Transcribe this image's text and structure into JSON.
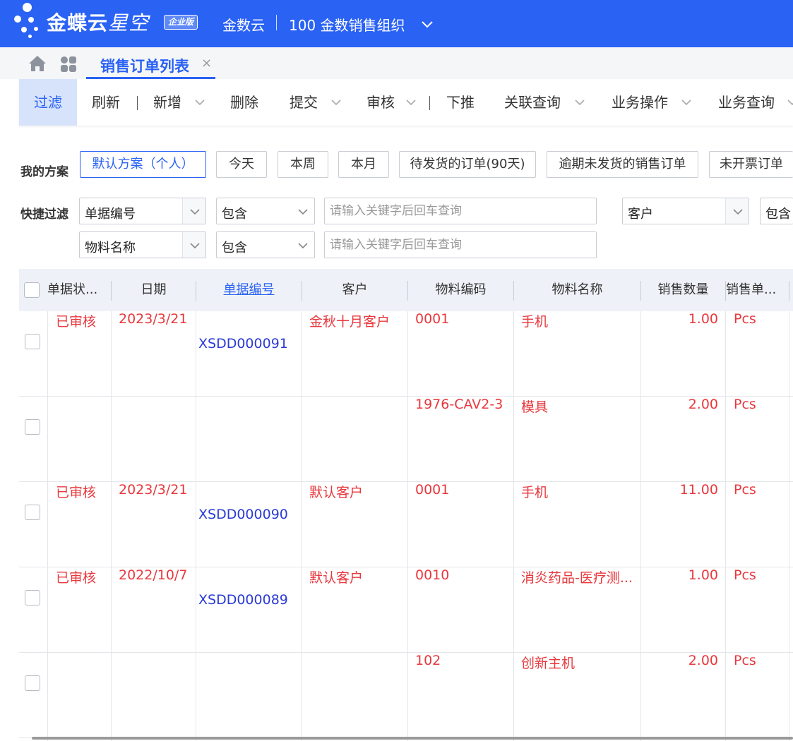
{
  "header": {
    "brand": "金蝶云",
    "brand_suffix": "星空",
    "edition": "企业版",
    "tenant": "金数云",
    "org": "100 金数销售组织",
    "accent": "#2a62f4"
  },
  "tabs": {
    "active_label": "销售订单列表",
    "close_glyph": "×"
  },
  "toolbar": {
    "filter": "过滤",
    "refresh": "刷新",
    "add": "新增",
    "delete": "删除",
    "submit": "提交",
    "audit": "审核",
    "push_down": "下推",
    "related_query": "关联查询",
    "business_ops": "业务操作",
    "business_query": "业务查询"
  },
  "filters": {
    "scheme_label": "我的方案",
    "schemes": [
      "默认方案（个人）",
      "今天",
      "本周",
      "本月",
      "待发货的订单(90天)",
      "逾期未发货的销售订单",
      "未开票订单"
    ],
    "quick_label": "快捷过滤",
    "row1": {
      "field": "单据编号",
      "op": "包含",
      "placeholder": "请输入关键字后回车查询",
      "field2": "客户",
      "op2": "包含"
    },
    "row2": {
      "field": "物料名称",
      "op": "包含",
      "placeholder": "请输入关键字后回车查询"
    }
  },
  "grid": {
    "columns": [
      "单据状...",
      "日期",
      "单据编号",
      "客户",
      "物料编码",
      "物料名称",
      "销售数量",
      "销售单..."
    ],
    "row_color": "#e8383d",
    "link_color": "#2b3bd6",
    "rows": [
      {
        "status": "已审核",
        "date": "2023/3/21",
        "bill_no": "XSDD000091",
        "customer": "金秋十月客户",
        "material_code": "0001",
        "material_name": "手机",
        "qty": "1.00",
        "unit": "Pcs"
      },
      {
        "status": "",
        "date": "",
        "bill_no": "",
        "customer": "",
        "material_code": "1976-CAV2-3",
        "material_name": "模具",
        "qty": "2.00",
        "unit": "Pcs"
      },
      {
        "status": "已审核",
        "date": "2023/3/21",
        "bill_no": "XSDD000090",
        "customer": "默认客户",
        "material_code": "0001",
        "material_name": "手机",
        "qty": "11.00",
        "unit": "Pcs"
      },
      {
        "status": "已审核",
        "date": "2022/10/7",
        "bill_no": "XSDD000089",
        "customer": "默认客户",
        "material_code": "0010",
        "material_name": "消炎药品-医疗测...",
        "qty": "1.00",
        "unit": "Pcs"
      },
      {
        "status": "",
        "date": "",
        "bill_no": "",
        "customer": "",
        "material_code": "102",
        "material_name": "创新主机",
        "qty": "2.00",
        "unit": "Pcs"
      }
    ]
  }
}
